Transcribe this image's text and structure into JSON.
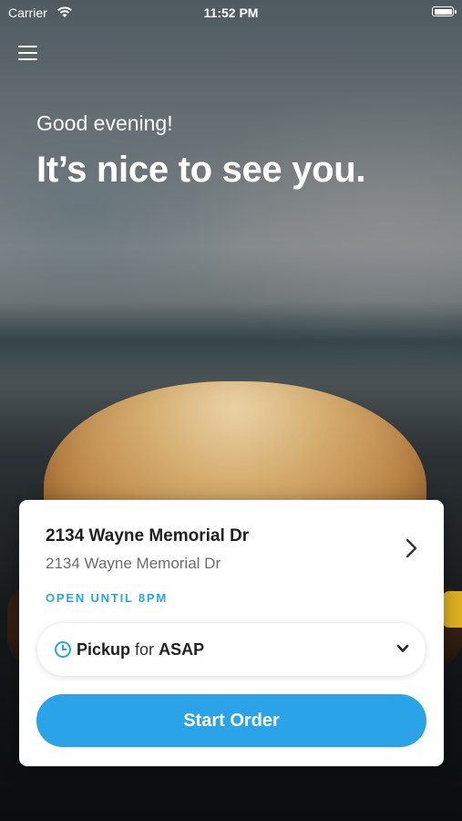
{
  "status_bar": {
    "carrier": "Carrier",
    "time": "11:52 PM"
  },
  "hero": {
    "greeting": "Good evening!",
    "headline": "It’s nice to see you."
  },
  "store_card": {
    "name": "2134 Wayne Memorial Dr",
    "address": "2134 Wayne Memorial Dr",
    "hours": "OPEN UNTIL 8PM",
    "order_type": {
      "mode": "Pickup",
      "connector": "for",
      "time": "ASAP"
    },
    "start_button_label": "Start Order"
  },
  "colors": {
    "accent": "#2aa3e8",
    "card_background": "#ffffff"
  },
  "icons": [
    "wifi-icon",
    "battery-icon",
    "menu-icon",
    "chevron-right-icon",
    "clock-icon",
    "chevron-down-icon"
  ]
}
